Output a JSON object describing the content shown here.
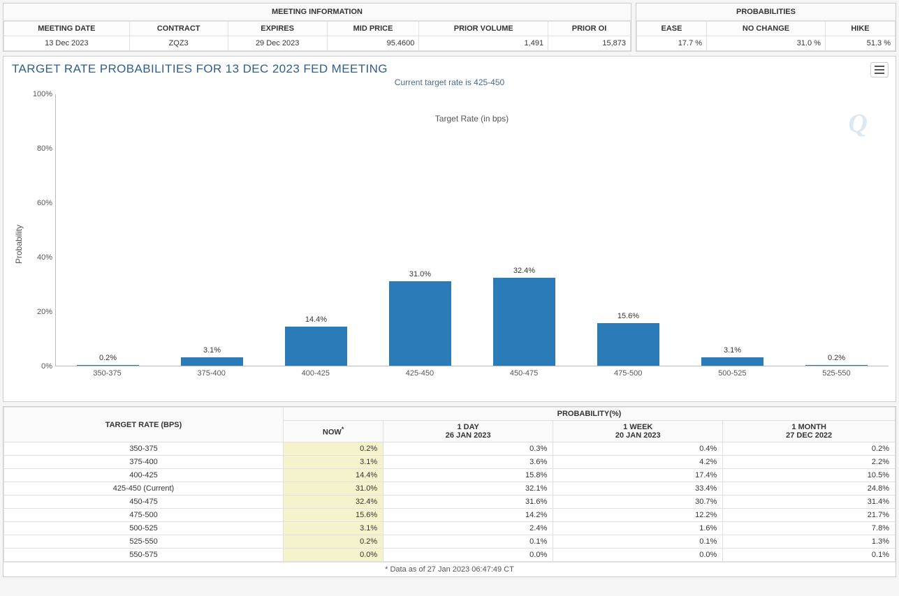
{
  "meeting_info": {
    "panel_title": "MEETING INFORMATION",
    "headers": [
      "MEETING DATE",
      "CONTRACT",
      "EXPIRES",
      "MID PRICE",
      "PRIOR VOLUME",
      "PRIOR OI"
    ],
    "values": [
      "13 Dec 2023",
      "ZQZ3",
      "29 Dec 2023",
      "95.4600",
      "1,491",
      "15,873"
    ]
  },
  "probabilities": {
    "panel_title": "PROBABILITIES",
    "headers": [
      "EASE",
      "NO CHANGE",
      "HIKE"
    ],
    "values": [
      "17.7 %",
      "31.0 %",
      "51.3 %"
    ]
  },
  "chart": {
    "title": "TARGET RATE PROBABILITIES FOR 13 DEC 2023 FED MEETING",
    "subtitle": "Current target rate is 425-450",
    "ylabel": "Probability",
    "xlabel": "Target Rate (in bps)",
    "logo": "Q"
  },
  "chart_data": {
    "type": "bar",
    "categories": [
      "350-375",
      "375-400",
      "400-425",
      "425-450",
      "450-475",
      "475-500",
      "500-525",
      "525-550"
    ],
    "values": [
      0.2,
      3.1,
      14.4,
      31.0,
      32.4,
      15.6,
      3.1,
      0.2
    ],
    "value_labels": [
      "0.2%",
      "3.1%",
      "14.4%",
      "31.0%",
      "32.4%",
      "15.6%",
      "3.1%",
      "0.2%"
    ],
    "title": "TARGET RATE PROBABILITIES FOR 13 DEC 2023 FED MEETING",
    "subtitle": "Current target rate is 425-450",
    "xlabel": "Target Rate (in bps)",
    "ylabel": "Probability",
    "ylim": [
      0,
      100
    ],
    "yticks": [
      0,
      20,
      40,
      60,
      80,
      100
    ],
    "ytick_labels": [
      "0%",
      "20%",
      "40%",
      "60%",
      "80%",
      "100%"
    ]
  },
  "history": {
    "rate_header": "TARGET RATE (BPS)",
    "prob_header": "PROBABILITY(%)",
    "cols": [
      {
        "top": "NOW",
        "sup": "*",
        "sub": ""
      },
      {
        "top": "1 DAY",
        "sup": "",
        "sub": "26 JAN 2023"
      },
      {
        "top": "1 WEEK",
        "sup": "",
        "sub": "20 JAN 2023"
      },
      {
        "top": "1 MONTH",
        "sup": "",
        "sub": "27 DEC 2022"
      }
    ],
    "rows": [
      {
        "rate": "350-375",
        "vals": [
          "0.2%",
          "0.3%",
          "0.4%",
          "0.2%"
        ]
      },
      {
        "rate": "375-400",
        "vals": [
          "3.1%",
          "3.6%",
          "4.2%",
          "2.2%"
        ]
      },
      {
        "rate": "400-425",
        "vals": [
          "14.4%",
          "15.8%",
          "17.4%",
          "10.5%"
        ]
      },
      {
        "rate": "425-450 (Current)",
        "vals": [
          "31.0%",
          "32.1%",
          "33.4%",
          "24.8%"
        ]
      },
      {
        "rate": "450-475",
        "vals": [
          "32.4%",
          "31.6%",
          "30.7%",
          "31.4%"
        ]
      },
      {
        "rate": "475-500",
        "vals": [
          "15.6%",
          "14.2%",
          "12.2%",
          "21.7%"
        ]
      },
      {
        "rate": "500-525",
        "vals": [
          "3.1%",
          "2.4%",
          "1.6%",
          "7.8%"
        ]
      },
      {
        "rate": "525-550",
        "vals": [
          "0.2%",
          "0.1%",
          "0.1%",
          "1.3%"
        ]
      },
      {
        "rate": "550-575",
        "vals": [
          "0.0%",
          "0.0%",
          "0.0%",
          "0.1%"
        ]
      }
    ],
    "footer": "* Data as of 27 Jan 2023 06:47:49 CT"
  }
}
